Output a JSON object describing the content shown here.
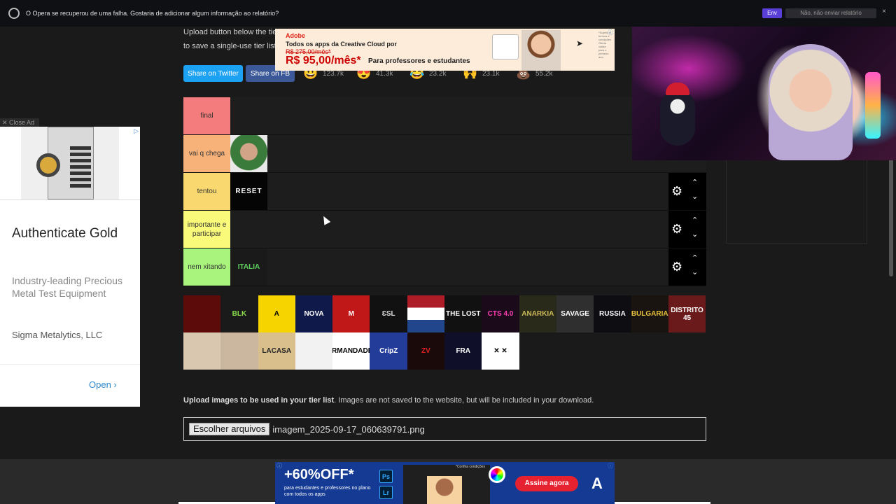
{
  "crash_bar": {
    "message": "O Opera se recuperou de uma falha. Gostaria de adicionar algum informação ao relatório?",
    "send_label": "Env",
    "dont_send_label": "Não, não enviar relatório",
    "close": "×"
  },
  "page": {
    "intro_line1": "Upload button below the tier list to add more images or drag and drop images from your computer. Click the download im",
    "intro_line2": "to save a single-use tier list."
  },
  "share": {
    "twitter": "Share on Twitter",
    "facebook": "Share on FB",
    "reactions": [
      {
        "icon": "grin-emoji-icon",
        "glyph": "😃",
        "count": "123.7k"
      },
      {
        "icon": "heart-eyes-emoji-icon",
        "glyph": "😍",
        "count": "41.3k"
      },
      {
        "icon": "laughing-emoji-icon",
        "glyph": "😂",
        "count": "23.2k"
      },
      {
        "icon": "raised-hands-emoji-icon",
        "glyph": "🙌",
        "count": "23.1k"
      },
      {
        "icon": "poop-emoji-icon",
        "glyph": "💩",
        "count": "55.2k"
      }
    ]
  },
  "ad_top": {
    "brand": "Adobe",
    "line1": "Todos os apps da Creative Cloud por",
    "old_price": "R$ 275,00/mês*",
    "price": "R$ 95,00/mês*",
    "line2": "Para professores e estudantes",
    "fine_print": "*Sujeito a termos e condições. Oferta válida para o primeiro ano.",
    "ad_info": "ⓘ",
    "accent": "#e1251b"
  },
  "tiers": [
    {
      "label": "final",
      "color": "#f47c7c",
      "items": []
    },
    {
      "label": "vai q chega",
      "color": "#f7b27a",
      "items": [
        "player-photo"
      ]
    },
    {
      "label": "tentou",
      "color": "#f9d86f",
      "items": [
        "reset"
      ]
    },
    {
      "label": "importante e participar",
      "color": "#f9f97a",
      "items": []
    },
    {
      "label": "nem xitando",
      "color": "#a9f47c",
      "items": [
        "italia"
      ]
    }
  ],
  "tier_items_text": {
    "reset": "RESET",
    "italia": "ITALIA"
  },
  "pool": [
    {
      "name": "demon-logo",
      "text": "",
      "bg": "#5c0a0a",
      "fg": "#fff"
    },
    {
      "name": "blk-skull-logo",
      "text": "BLK",
      "bg": "#1a1a1a",
      "fg": "#8be04b"
    },
    {
      "name": "eagle-a-logo",
      "text": "A",
      "bg": "#f5d400",
      "fg": "#000"
    },
    {
      "name": "nova-logo",
      "text": "NOVA",
      "bg": "#101a4a",
      "fg": "#fff"
    },
    {
      "name": "m-logo",
      "text": "M",
      "bg": "#c01818",
      "fg": "#fff"
    },
    {
      "name": "gothic-logo",
      "text": "ƐSL",
      "bg": "#111",
      "fg": "#ddd"
    },
    {
      "name": "netherlands-flag",
      "text": "",
      "bg": "linear-gradient(#ae1c28 0 33%, #ffffff 33% 66%, #21468b 66%)",
      "fg": "#000"
    },
    {
      "name": "the-lost-logo",
      "text": "THE LOST",
      "bg": "#111",
      "fg": "#fff"
    },
    {
      "name": "cts-logo",
      "text": "CTS 4.0",
      "bg": "#1a0a1a",
      "fg": "#ff3fb5"
    },
    {
      "name": "anarkia-logo",
      "text": "ANARKIA",
      "bg": "#2a2a1a",
      "fg": "#cdbb5a"
    },
    {
      "name": "savage-logo",
      "text": "SAVAGE",
      "bg": "#2f2f2f",
      "fg": "#fff"
    },
    {
      "name": "russia-logo",
      "text": "RUSSIA",
      "bg": "#0d0d12",
      "fg": "#fff"
    },
    {
      "name": "bulgaria-logo",
      "text": "BULGARIA",
      "bg": "#1a1410",
      "fg": "#e8c23c"
    },
    {
      "name": "distrito-45-logo",
      "text": "DISTRITO 45",
      "bg": "#6a1a1a",
      "fg": "#fff"
    },
    {
      "name": "player-photo-2",
      "text": "",
      "bg": "#d9c7b0",
      "fg": "#000"
    },
    {
      "name": "player-photo-3",
      "text": "",
      "bg": "#cbb7a0",
      "fg": "#000"
    },
    {
      "name": "lacasa-logo",
      "text": "LACASA",
      "bg": "#d9bf8c",
      "fg": "#222"
    },
    {
      "name": "anonymous-mask-logo",
      "text": "",
      "bg": "#f2f2f2",
      "fg": "#000"
    },
    {
      "name": "irmandade-logo",
      "text": "IRMANDADE",
      "bg": "#ffffff",
      "fg": "#000"
    },
    {
      "name": "cripz-logo",
      "text": "CripZ",
      "bg": "#233c9a",
      "fg": "#fff"
    },
    {
      "name": "red-tag-logo",
      "text": "ZV",
      "bg": "#1a0a0a",
      "fg": "#e02020"
    },
    {
      "name": "fra-logo",
      "text": "FRA",
      "bg": "#0f0f2a",
      "fg": "#fff"
    },
    {
      "name": "smiley-logo",
      "text": "✕ ✕",
      "bg": "#ffffff",
      "fg": "#000"
    }
  ],
  "upload": {
    "bold_text": "Upload images to be used in your tier list",
    "rest_text": ". Images are not saved to the website, but will be included in your download.",
    "button": "Escolher arquivos",
    "file_name": "imagem_2025-09-17_060639791.png"
  },
  "ad_left": {
    "close_label": "✕ Close Ad",
    "headline": "Authenticate Gold",
    "description": "Industry-leading Precious Metal Test Equipment",
    "advertiser": "Sigma Metalytics, LLC",
    "cta": "Open ›",
    "ad_info": "▷"
  },
  "ad_bottom": {
    "headline": "+60%OFF*",
    "sub": "para estudantes e professores no plano com todos os apps",
    "ps": "Ps",
    "lr": "Lr",
    "note": "*Confira condições",
    "cta": "Assine agora",
    "logo": "A",
    "ad_info": "ⓘ",
    "ad_info_left": "ⓘ",
    "accent": "#e72230"
  }
}
